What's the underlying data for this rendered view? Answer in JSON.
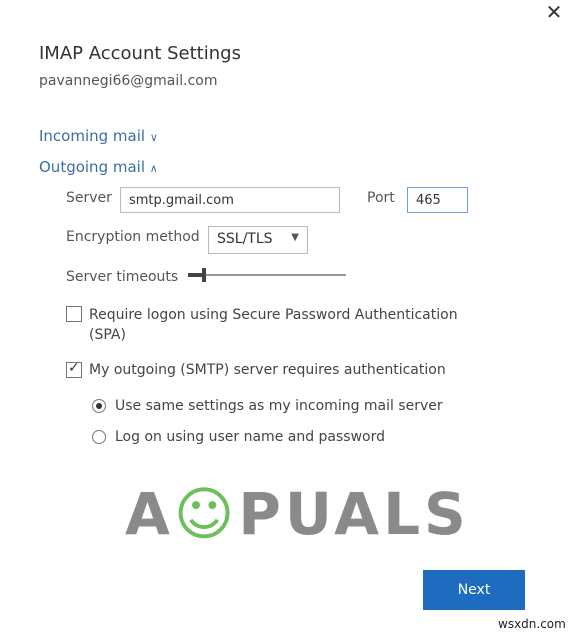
{
  "dialog": {
    "title": "IMAP Account Settings",
    "email": "pavannegi66@gmail.com",
    "close_icon": "close-icon"
  },
  "incoming": {
    "label": "Incoming mail",
    "state": "collapsed"
  },
  "outgoing": {
    "label": "Outgoing mail",
    "state": "expanded",
    "server_label": "Server",
    "server_value": "smtp.gmail.com",
    "port_label": "Port",
    "port_value": "465",
    "encryption_label": "Encryption method",
    "encryption_value": "SSL/TLS",
    "timeout_label": "Server timeouts",
    "timeout_level": 0.1,
    "spa_label": "Require logon using Secure Password Authentication",
    "spa_label2": "(SPA)",
    "spa_checked": false,
    "auth_label": "My outgoing (SMTP) server requires authentication",
    "auth_checked": true,
    "radio_same": "Use same settings as my incoming mail server",
    "radio_logon": "Log on using user name and password",
    "selected_radio": "same"
  },
  "next_label": "Next",
  "accent": "#1e6cc0",
  "watermark": {
    "logo": "APPUALS",
    "site": "wsxdn.com"
  }
}
